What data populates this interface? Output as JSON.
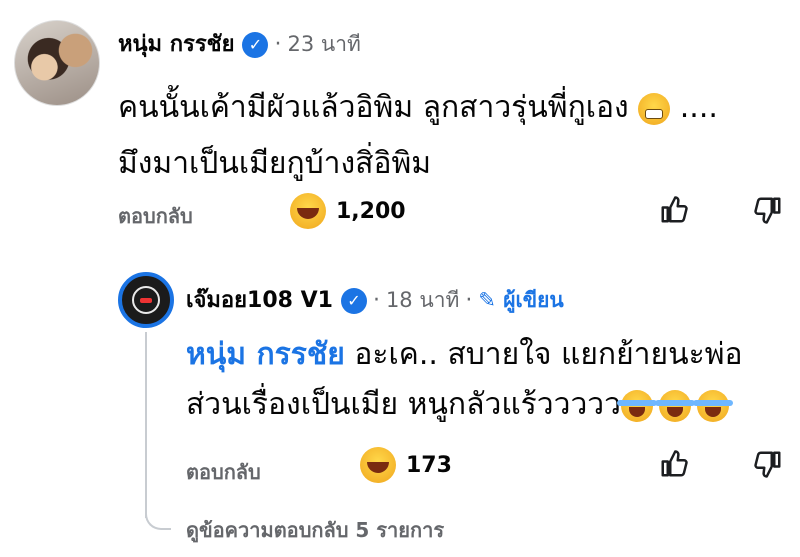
{
  "comment": {
    "author": "หนุ่ม กรรชัย",
    "time": "23 นาที",
    "text_line1": "คนนั้นเค้ามีผัวแล้วอิพิม ลูกสาวรุ่นพี่กูเอง",
    "text_line1_suffix": "....",
    "text_line2": "มึงมาเป็นเมียกูบ้างสิ่อิพิม",
    "reply_label": "ตอบกลับ",
    "reaction_count": "1,200"
  },
  "reply": {
    "author": "เจ๊มอย108 V1",
    "time": "18 นาที",
    "author_badge": "ผู้เขียน",
    "mention": "หนุ่ม กรรชัย",
    "text_line1": "อะเค.. สบายใจ แยกย้ายนะพ่อ",
    "text_line2": "ส่วนเรื่องเป็นเมีย หนูกลัวแร้ววววว",
    "reply_label": "ตอบกลับ",
    "reaction_count": "173"
  },
  "view_replies": "ดูข้อความตอบกลับ 5 รายการ",
  "colors": {
    "accent": "#1b74e4",
    "muted": "#65676b",
    "text": "#050505"
  }
}
